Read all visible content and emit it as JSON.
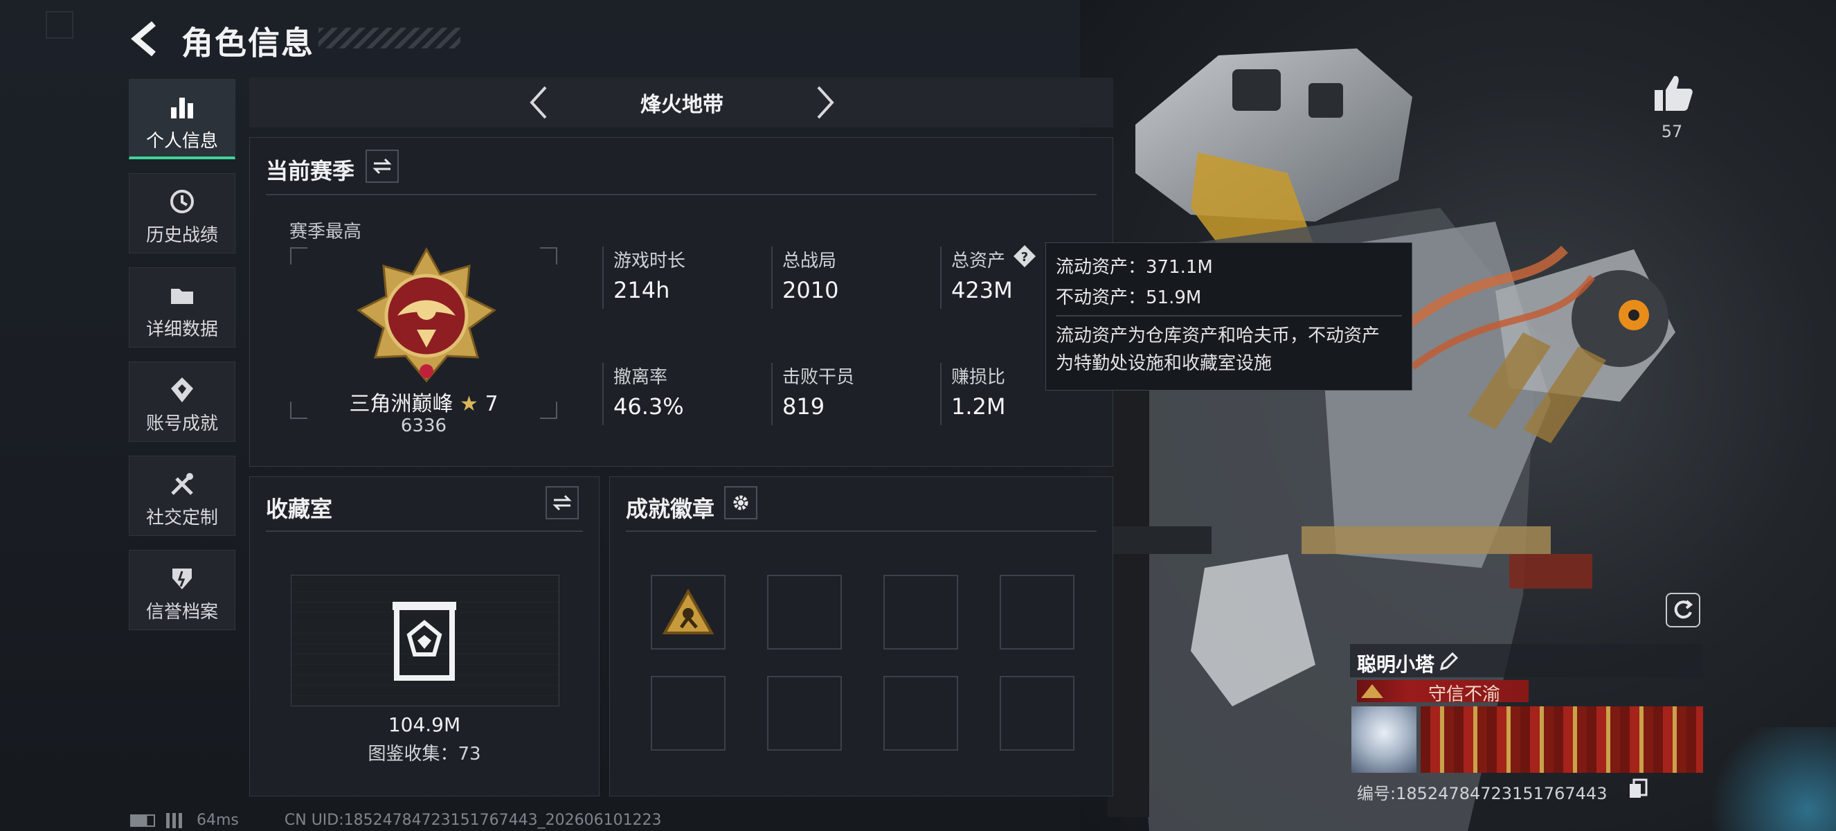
{
  "header": {
    "title": "角色信息"
  },
  "nav": {
    "items": [
      {
        "label": "个人信息",
        "icon": "bar-chart-icon",
        "active": true
      },
      {
        "label": "历史战绩",
        "icon": "clock-history-icon",
        "active": false
      },
      {
        "label": "详细数据",
        "icon": "folder-icon",
        "active": false
      },
      {
        "label": "账号成就",
        "icon": "achievement-icon",
        "active": false
      },
      {
        "label": "社交定制",
        "icon": "tools-icon",
        "active": false
      },
      {
        "label": "信誉档案",
        "icon": "shield-icon",
        "active": false
      }
    ]
  },
  "mode": {
    "title": "烽火地带"
  },
  "season": {
    "title": "当前赛季",
    "best_label": "赛季最高",
    "rank_name": "三角洲巅峰",
    "rank_star": "7",
    "rank_score": "6336",
    "stats": [
      {
        "label": "游戏时长",
        "value": "214h"
      },
      {
        "label": "总战局",
        "value": "2010"
      },
      {
        "label": "总资产",
        "value": "423M"
      },
      {
        "label": "撤离率",
        "value": "46.3%"
      },
      {
        "label": "击败干员",
        "value": "819"
      },
      {
        "label": "赚损比",
        "value": "1.2M"
      }
    ]
  },
  "tooltip": {
    "liquid": "流动资产：371.1M",
    "fixed": "不动资产：51.9M",
    "desc_1": "流动资产为仓库资产和哈夫币，不动资产",
    "desc_2": "为特勤处设施和收藏室设施"
  },
  "collection": {
    "title": "收藏室",
    "value": "104.9M",
    "catalog": "图鉴收集：73"
  },
  "badges": {
    "title": "成就徽章",
    "slots": 8
  },
  "likes": {
    "count": "57"
  },
  "player": {
    "name": "聪明小塔",
    "title": "守信不渝",
    "uid_line": "编号:18524784723151767443"
  },
  "footer": {
    "ping": "64ms",
    "uid": "CN UID:18524784723151767443_202606101223"
  },
  "colors": {
    "accent": "#3fd39a",
    "banner_red": "#9a1b1b",
    "gold": "#c9a24a"
  }
}
